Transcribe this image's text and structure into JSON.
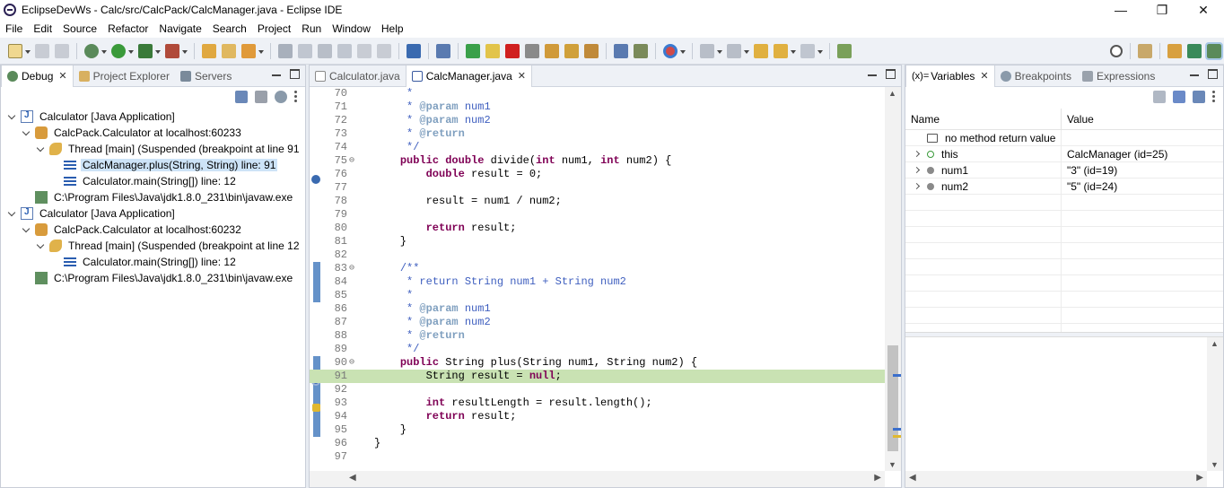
{
  "window": {
    "title": "EclipseDevWs - Calc/src/CalcPack/CalcManager.java - Eclipse IDE",
    "minimize": "—",
    "restore": "❐",
    "close": "✕"
  },
  "menu": [
    "File",
    "Edit",
    "Source",
    "Refactor",
    "Navigate",
    "Search",
    "Project",
    "Run",
    "Window",
    "Help"
  ],
  "left_panel": {
    "tabs": [
      {
        "label": "Debug",
        "active": true
      },
      {
        "label": "Project Explorer",
        "active": false
      },
      {
        "label": "Servers",
        "active": false
      }
    ],
    "tree": [
      {
        "level": 0,
        "icon": "app",
        "label": "Calculator [Java Application]",
        "twisty": true,
        "selected": false
      },
      {
        "level": 1,
        "icon": "vm",
        "label": "CalcPack.Calculator at localhost:60233",
        "twisty": true,
        "selected": false
      },
      {
        "level": 2,
        "icon": "thread",
        "label": "Thread [main] (Suspended (breakpoint at line 91",
        "twisty": true,
        "selected": false
      },
      {
        "level": 3,
        "icon": "frame",
        "label": "CalcManager.plus(String, String) line: 91",
        "twisty": false,
        "selected": true
      },
      {
        "level": 3,
        "icon": "frame",
        "label": "Calculator.main(String[]) line: 12",
        "twisty": false,
        "selected": false
      },
      {
        "level": 1,
        "icon": "proc",
        "label": "C:\\Program Files\\Java\\jdk1.8.0_231\\bin\\javaw.exe",
        "twisty": false,
        "selected": false
      },
      {
        "level": 0,
        "icon": "app",
        "label": "Calculator [Java Application]",
        "twisty": true,
        "selected": false
      },
      {
        "level": 1,
        "icon": "vm",
        "label": "CalcPack.Calculator at localhost:60232",
        "twisty": true,
        "selected": false
      },
      {
        "level": 2,
        "icon": "thread",
        "label": "Thread [main] (Suspended (breakpoint at line 12",
        "twisty": true,
        "selected": false
      },
      {
        "level": 3,
        "icon": "frame",
        "label": "Calculator.main(String[]) line: 12",
        "twisty": false,
        "selected": false
      },
      {
        "level": 1,
        "icon": "proc",
        "label": "C:\\Program Files\\Java\\jdk1.8.0_231\\bin\\javaw.exe",
        "twisty": false,
        "selected": false
      }
    ]
  },
  "editor": {
    "tabs": [
      {
        "label": "Calculator.java",
        "active": false
      },
      {
        "label": "CalcManager.java",
        "active": true
      }
    ],
    "current_line": 91,
    "lines": [
      {
        "n": "70",
        "fold": "",
        "html": "     <span class=\"cm\">*</span>"
      },
      {
        "n": "71",
        "fold": "",
        "html": "     <span class=\"cm\">* </span><span class=\"jd\">@param</span><span class=\"cm\"> num1</span>"
      },
      {
        "n": "72",
        "fold": "",
        "html": "     <span class=\"cm\">* </span><span class=\"jd\">@param</span><span class=\"cm\"> num2</span>"
      },
      {
        "n": "73",
        "fold": "",
        "html": "     <span class=\"cm\">* </span><span class=\"jd\">@return</span>"
      },
      {
        "n": "74",
        "fold": "",
        "html": "     <span class=\"cm\">*/</span>"
      },
      {
        "n": "75",
        "fold": "⊖",
        "html": "    <span class=\"kw\">public double</span> divide(<span class=\"kw\">int</span> num1, <span class=\"kw\">int</span> num2) {"
      },
      {
        "n": "76",
        "fold": "",
        "html": "        <span class=\"kw\">double</span> result = 0;"
      },
      {
        "n": "77",
        "fold": "",
        "html": ""
      },
      {
        "n": "78",
        "fold": "",
        "html": "        result = num1 / num2;"
      },
      {
        "n": "79",
        "fold": "",
        "html": ""
      },
      {
        "n": "80",
        "fold": "",
        "html": "        <span class=\"kw\">return</span> result;"
      },
      {
        "n": "81",
        "fold": "",
        "html": "    }"
      },
      {
        "n": "82",
        "fold": "",
        "html": ""
      },
      {
        "n": "83",
        "fold": "⊖",
        "html": "    <span class=\"cm\">/**</span>"
      },
      {
        "n": "84",
        "fold": "",
        "html": "     <span class=\"cm\">* return String num1 + String num2</span>"
      },
      {
        "n": "85",
        "fold": "",
        "html": "     <span class=\"cm\">*</span>"
      },
      {
        "n": "86",
        "fold": "",
        "html": "     <span class=\"cm\">* </span><span class=\"jd\">@param</span><span class=\"cm\"> num1</span>"
      },
      {
        "n": "87",
        "fold": "",
        "html": "     <span class=\"cm\">* </span><span class=\"jd\">@param</span><span class=\"cm\"> num2</span>"
      },
      {
        "n": "88",
        "fold": "",
        "html": "     <span class=\"cm\">* </span><span class=\"jd\">@return</span>"
      },
      {
        "n": "89",
        "fold": "",
        "html": "     <span class=\"cm\">*/</span>"
      },
      {
        "n": "90",
        "fold": "⊖",
        "html": "    <span class=\"kw\">public</span> String plus(String num1, String num2) {"
      },
      {
        "n": "91",
        "fold": "",
        "html": "        String result = <span class=\"kw\">null</span>;"
      },
      {
        "n": "92",
        "fold": "",
        "html": ""
      },
      {
        "n": "93",
        "fold": "",
        "html": "        <span class=\"kw\">int</span> resultLength = result.length();"
      },
      {
        "n": "94",
        "fold": "",
        "html": "        <span class=\"kw\">return</span> result;"
      },
      {
        "n": "95",
        "fold": "",
        "html": "    }"
      },
      {
        "n": "96",
        "fold": "",
        "html": "}"
      },
      {
        "n": "97",
        "fold": "",
        "html": ""
      }
    ]
  },
  "right_panel": {
    "tabs": [
      {
        "label": "Variables",
        "prefix": "(x)=",
        "active": true
      },
      {
        "label": "Breakpoints",
        "prefix": "",
        "active": false
      },
      {
        "label": "Expressions",
        "prefix": "",
        "active": false
      }
    ],
    "columns": {
      "name": "Name",
      "value": "Value"
    },
    "variables": [
      {
        "expandable": false,
        "icon": "ret",
        "name": "no method return value",
        "value": ""
      },
      {
        "expandable": true,
        "icon": "pub",
        "name": "this",
        "value": "CalcManager  (id=25)"
      },
      {
        "expandable": true,
        "icon": "loc",
        "name": "num1",
        "value": "\"3\" (id=19)"
      },
      {
        "expandable": true,
        "icon": "loc",
        "name": "num2",
        "value": "\"5\" (id=24)"
      }
    ],
    "empty_rows": 10
  }
}
